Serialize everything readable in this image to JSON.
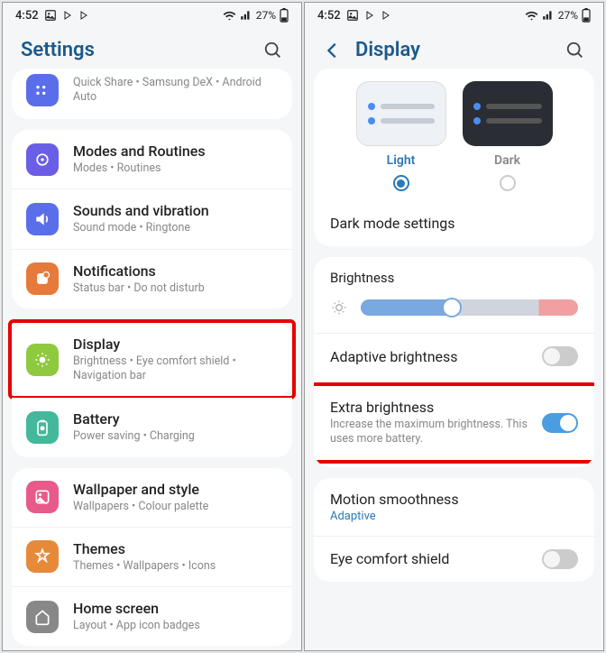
{
  "status": {
    "time": "4:52",
    "battery": "27%"
  },
  "left": {
    "title": "Settings",
    "partial": {
      "sub": "Quick Share  •  Samsung DeX  •  Android Auto"
    },
    "group1": [
      {
        "title": "Modes and Routines",
        "sub": "Modes  •  Routines",
        "icon": "icon-blue2",
        "name": "modes-routines"
      },
      {
        "title": "Sounds and vibration",
        "sub": "Sound mode  •  Ringtone",
        "icon": "icon-blue",
        "name": "sounds-vibration"
      },
      {
        "title": "Notifications",
        "sub": "Status bar  •  Do not disturb",
        "icon": "icon-orange",
        "name": "notifications"
      }
    ],
    "display": {
      "title": "Display",
      "sub": "Brightness  •  Eye comfort shield  •  Navigation bar"
    },
    "battery": {
      "title": "Battery",
      "sub": "Power saving  •  Charging"
    },
    "group2": [
      {
        "title": "Wallpaper and style",
        "sub": "Wallpapers  •  Colour palette",
        "icon": "icon-pink",
        "name": "wallpaper"
      },
      {
        "title": "Themes",
        "sub": "Themes  •  Wallpapers  •  Icons",
        "icon": "icon-orange2",
        "name": "themes"
      },
      {
        "title": "Home screen",
        "sub": "Layout  •  App icon badges",
        "icon": "icon-gray",
        "name": "home-screen"
      }
    ]
  },
  "right": {
    "title": "Display",
    "theme": {
      "light": "Light",
      "dark": "Dark"
    },
    "dark_mode": "Dark mode settings",
    "brightness": "Brightness",
    "adaptive": "Adaptive brightness",
    "extra": {
      "title": "Extra brightness",
      "sub": "Increase the maximum brightness. This uses more battery."
    },
    "motion": {
      "title": "Motion smoothness",
      "link": "Adaptive"
    },
    "eye": "Eye comfort shield"
  }
}
